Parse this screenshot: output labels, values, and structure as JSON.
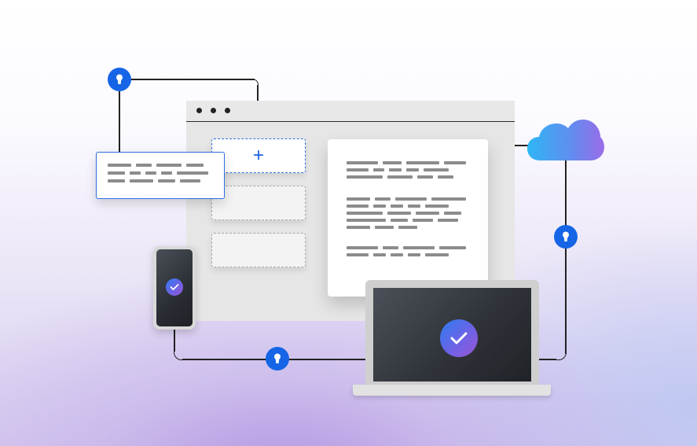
{
  "illustration": {
    "icons": {
      "lock": "keyhole-lock-icon",
      "cloud": "cloud-icon",
      "check": "checkmark-badge-icon",
      "add": "plus-icon"
    },
    "add_slot_symbol": "+",
    "colors": {
      "accent_blue": "#1565e6",
      "dashed_blue": "#2f6fe0",
      "cloud_start": "#2fb6f5",
      "cloud_end": "#9a6ce8",
      "check_start": "#2b7cf0",
      "check_end": "#9a55d8",
      "connector_line": "#222222"
    }
  }
}
